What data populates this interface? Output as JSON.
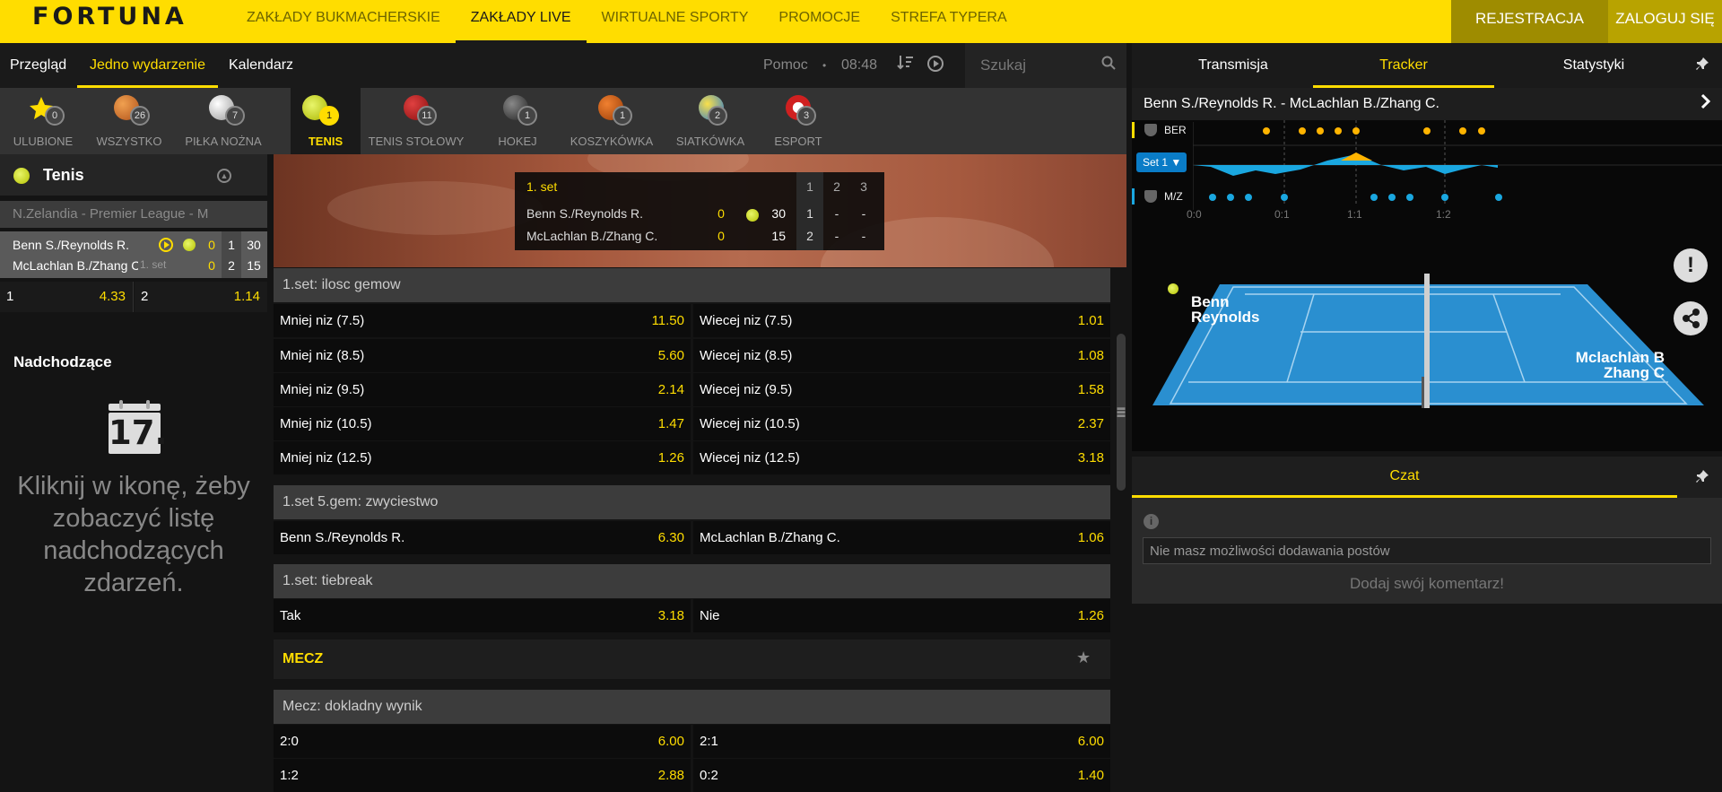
{
  "brand": {
    "logo": "FORTUNA",
    "accent": "#ffdd00"
  },
  "topnav": [
    {
      "label": "ZAKŁADY BUKMACHERSKIE",
      "active": false
    },
    {
      "label": "ZAKŁADY LIVE",
      "active": true
    },
    {
      "label": "WIRTUALNE SPORTY",
      "active": false
    },
    {
      "label": "PROMOCJE",
      "active": false
    },
    {
      "label": "STREFA TYPERA",
      "active": false
    }
  ],
  "auth": {
    "register": "REJESTRACJA",
    "login": "ZALOGUJ SIĘ"
  },
  "subnav": {
    "tabs": [
      "Przegląd",
      "Jedno wydarzenie",
      "Kalendarz"
    ],
    "active": "Jedno wydarzenie",
    "help": "Pomoc",
    "dot": "•",
    "time": "08:48"
  },
  "search": {
    "placeholder": "Szukaj"
  },
  "right_tabs": {
    "tabs": [
      "Transmisja",
      "Tracker",
      "Statystyki"
    ],
    "active": "Tracker"
  },
  "sports": [
    {
      "label": "ULUBIONE",
      "count": "0",
      "icon": "star-icon"
    },
    {
      "label": "WSZYSTKO",
      "count": "26",
      "icon": "all-sports-icon"
    },
    {
      "label": "PIŁKA NOŻNA",
      "count": "7",
      "icon": "football-icon"
    },
    {
      "label": "TENIS",
      "count": "1",
      "icon": "tennis-ball-icon",
      "active": true
    },
    {
      "label": "TENIS STOŁOWY",
      "count": "11",
      "icon": "table-tennis-icon"
    },
    {
      "label": "HOKEJ",
      "count": "1",
      "icon": "hockey-icon"
    },
    {
      "label": "KOSZYKÓWKA",
      "count": "1",
      "icon": "basketball-icon"
    },
    {
      "label": "SIATKÓWKA",
      "count": "2",
      "icon": "volleyball-icon"
    },
    {
      "label": "ESPORT",
      "count": "3",
      "icon": "esport-icon"
    }
  ],
  "left": {
    "sport": "Tenis",
    "league": "N.Zelandia - Premier League - M",
    "match": {
      "p1": "Benn S./Reynolds R.",
      "p2": "McLachlan B./Zhang C.",
      "set_tag": "1. set",
      "p1_games": "0",
      "p2_games": "0",
      "p1_sets": "1",
      "p2_sets": "2",
      "p1_points": "30",
      "p2_points": "15"
    },
    "odds": [
      {
        "k": "1",
        "v": "4.33"
      },
      {
        "k": "2",
        "v": "1.14"
      }
    ],
    "upcoming_title": "Nadchodzące",
    "calendar_day": "17.",
    "upcoming_msg": "Kliknij w ikonę, żeby zobaczyć listę nadchodzących zdarzeń."
  },
  "scoreboard": {
    "set_name": "1. set",
    "headers": [
      "1",
      "2",
      "3"
    ],
    "rows": [
      {
        "name": "Benn S./Reynolds R.",
        "games": "0",
        "points": "30",
        "sets": [
          "1",
          "-",
          "-"
        ]
      },
      {
        "name": "McLachlan B./Zhang C.",
        "games": "0",
        "points": "15",
        "sets": [
          "2",
          "-",
          "-"
        ]
      }
    ]
  },
  "markets": [
    {
      "title": "1.set: ilosc gemow",
      "rows": [
        [
          {
            "k": "Mniej niz (7.5)",
            "v": "11.50"
          },
          {
            "k": "Wiecej niz (7.5)",
            "v": "1.01"
          }
        ],
        [
          {
            "k": "Mniej niz (8.5)",
            "v": "5.60"
          },
          {
            "k": "Wiecej niz (8.5)",
            "v": "1.08"
          }
        ],
        [
          {
            "k": "Mniej niz (9.5)",
            "v": "2.14"
          },
          {
            "k": "Wiecej niz (9.5)",
            "v": "1.58"
          }
        ],
        [
          {
            "k": "Mniej niz (10.5)",
            "v": "1.47"
          },
          {
            "k": "Wiecej niz (10.5)",
            "v": "2.37"
          }
        ],
        [
          {
            "k": "Mniej niz (12.5)",
            "v": "1.26"
          },
          {
            "k": "Wiecej niz (12.5)",
            "v": "3.18"
          }
        ]
      ]
    },
    {
      "title": "1.set 5.gem: zwyciestwo",
      "rows": [
        [
          {
            "k": "Benn S./Reynolds R.",
            "v": "6.30"
          },
          {
            "k": "McLachlan B./Zhang C.",
            "v": "1.06"
          }
        ]
      ]
    },
    {
      "title": "1.set: tiebreak",
      "rows": [
        [
          {
            "k": "Tak",
            "v": "3.18"
          },
          {
            "k": "Nie",
            "v": "1.26"
          }
        ]
      ]
    }
  ],
  "mecz": {
    "section": "MECZ",
    "title": "Mecz: dokladny wynik",
    "rows": [
      [
        {
          "k": "2:0",
          "v": "6.00"
        },
        {
          "k": "2:1",
          "v": "6.00"
        }
      ],
      [
        {
          "k": "1:2",
          "v": "2.88"
        },
        {
          "k": "0:2",
          "v": "1.40"
        }
      ]
    ]
  },
  "tracker": {
    "title": "Benn S./Reynolds R. - McLachlan B./Zhang C.",
    "team_a": "BER",
    "team_b": "M/Z",
    "set_select": "Set 1",
    "timeline": [
      "0:0",
      "0:1",
      "1:1",
      "1:2"
    ],
    "court_a": [
      "Benn",
      "Reynolds"
    ],
    "court_b": [
      "Mclachlan B",
      "Zhang C"
    ],
    "colors": {
      "a": "#ffb400",
      "b": "#1aa7e0",
      "court": "#2a8fd0"
    }
  },
  "chat": {
    "tab": "Czat",
    "placeholder": "Nie masz możliwości dodawania postów",
    "cta": "Dodaj swój komentarz!"
  }
}
